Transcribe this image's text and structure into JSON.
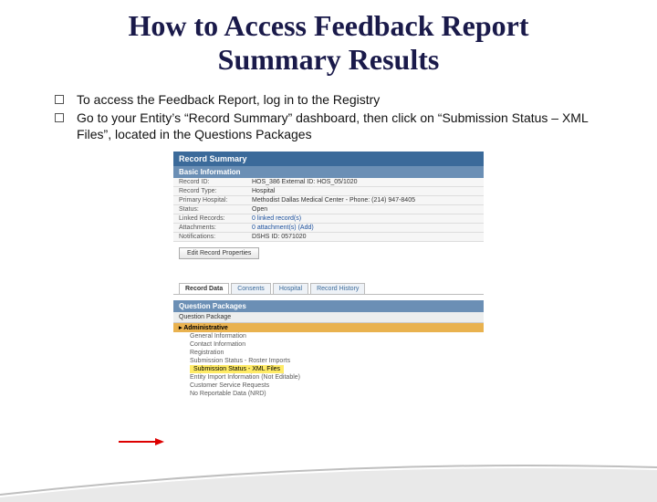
{
  "title_line1": "How to Access Feedback Report",
  "title_line2": "Summary Results",
  "bullets": [
    "To access the Feedback Report, log in to the Registry",
    "Go to your Entity’s “Record Summary” dashboard, then click on “Submission Status – XML Files”, located in the Questions Packages"
  ],
  "record_summary_label": "Record Summary",
  "basic_info_label": "Basic Information",
  "info_rows": {
    "record_id_label": "Record ID:",
    "record_id_value": "HOS_386  External ID: HOS_05/1020",
    "record_type_label": "Record Type:",
    "record_type_value": "Hospital",
    "primary_hospital_label": "Primary Hospital:",
    "primary_hospital_value": "Methodist Dallas Medical Center - Phone: (214) 947-8405",
    "status_label": "Status:",
    "status_value": "Open",
    "linked_records_label": "Linked Records:",
    "linked_records_value": "0 linked record(s)",
    "attachments_label": "Attachments:",
    "attachments_value": "0 attachment(s) (Add)",
    "notifications_label": "Notifications:",
    "notifications_value": "DSHS ID: 0571020"
  },
  "edit_button": "Edit Record Properties",
  "tabs": [
    "Record Data",
    "Consents",
    "Hospital",
    "Record History"
  ],
  "qp_header": "Question Packages",
  "qp_subhead": "Question Package",
  "qp_group": "Administrative",
  "qp_items": [
    "General Information",
    "Contact Information",
    "Registration",
    "Submission Status - Roster Imports",
    "Submission Status - XML Files",
    "Entity Import Information (Not Editable)",
    "Customer Service Requests",
    "No Reportable Data (NRD)"
  ]
}
